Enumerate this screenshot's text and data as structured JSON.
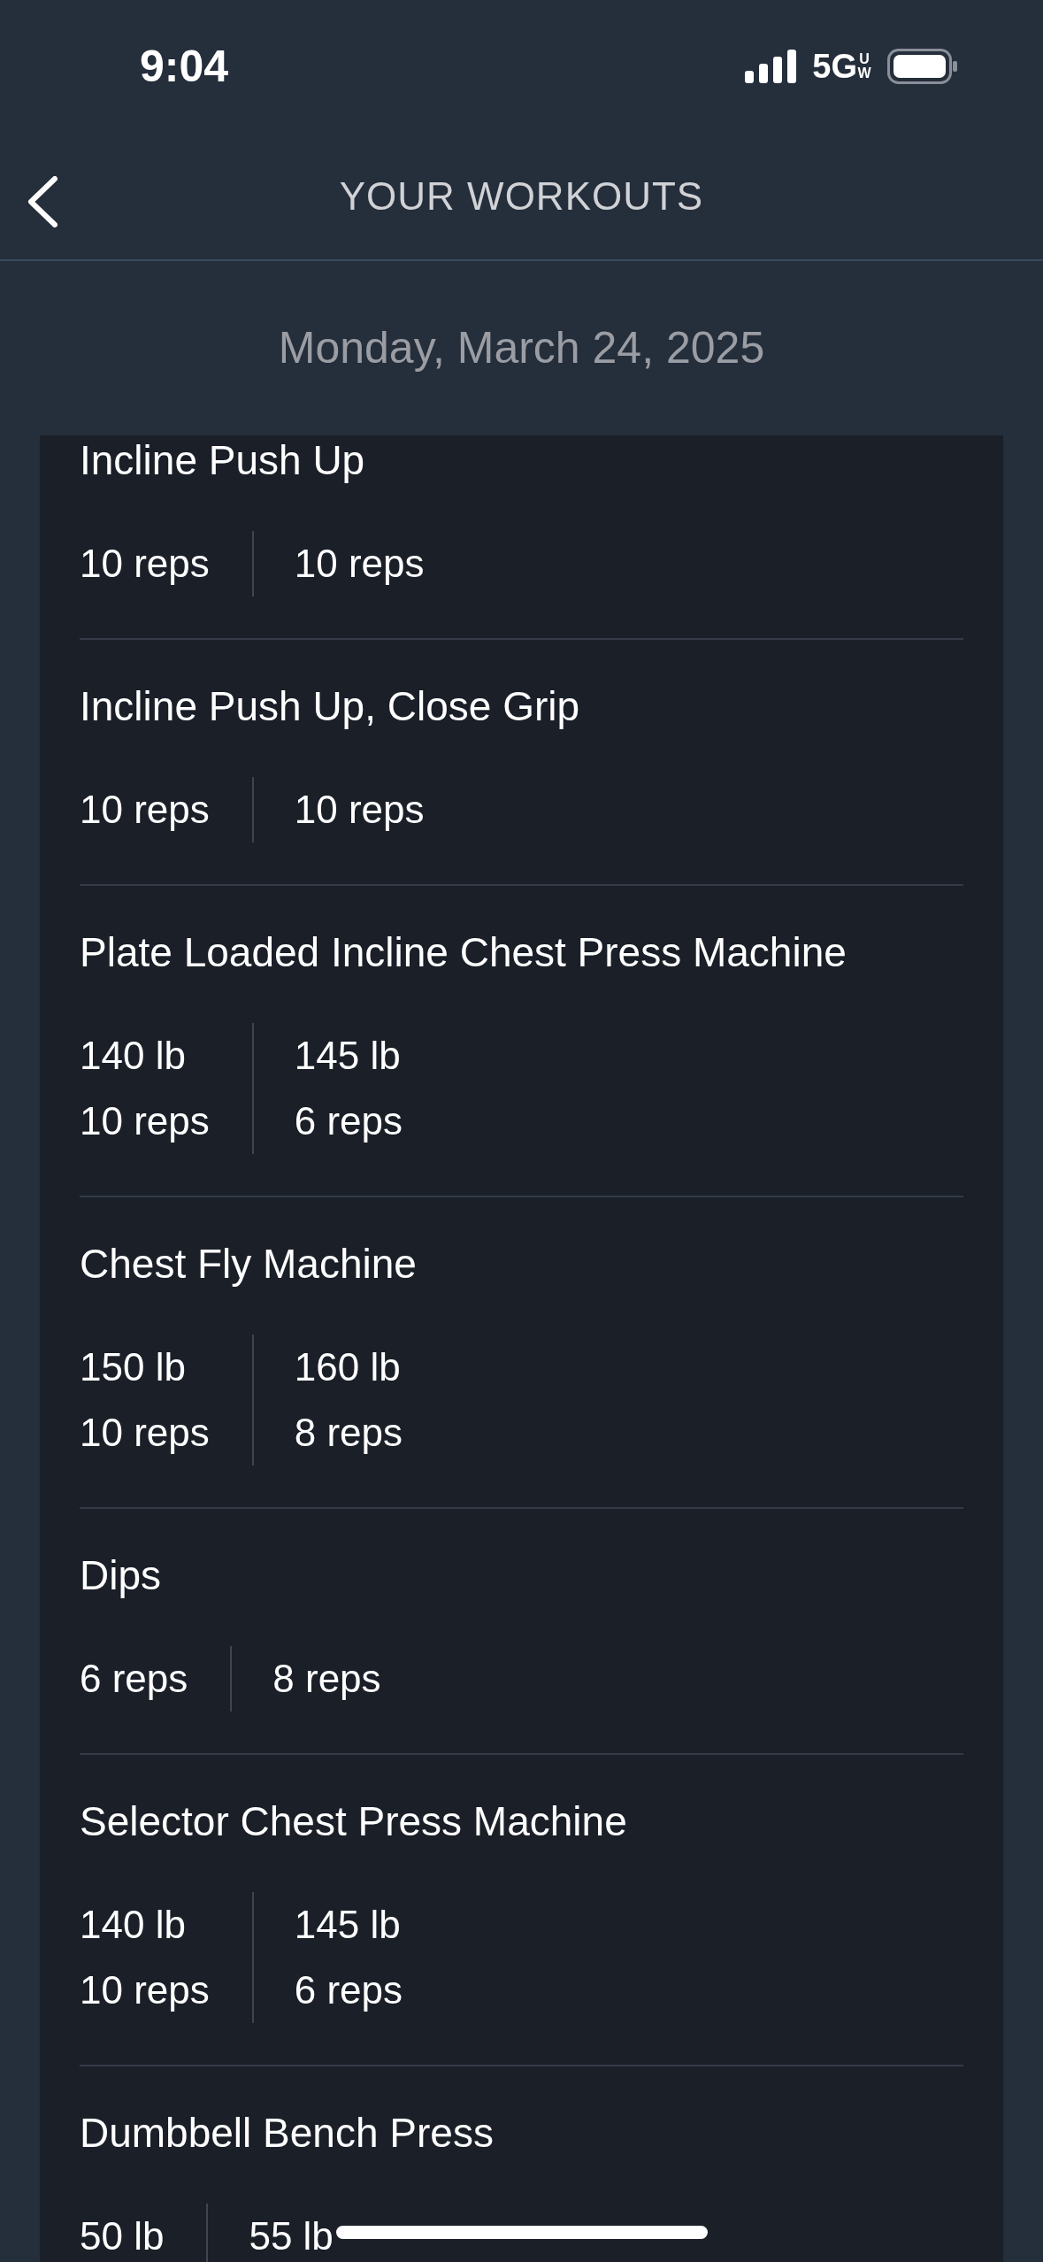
{
  "status_bar": {
    "time": "9:04",
    "network": "5G",
    "network_badge": "UW"
  },
  "header": {
    "title": "YOUR WORKOUTS"
  },
  "date": "Monday, March 24, 2025",
  "exercises": [
    {
      "name": "Incline Push Up",
      "sets": [
        {
          "reps": "10 reps"
        },
        {
          "reps": "10 reps"
        }
      ]
    },
    {
      "name": "Incline Push Up, Close Grip",
      "sets": [
        {
          "reps": "10 reps"
        },
        {
          "reps": "10 reps"
        }
      ]
    },
    {
      "name": "Plate Loaded Incline Chest Press Machine",
      "sets": [
        {
          "weight": "140 lb",
          "reps": "10 reps"
        },
        {
          "weight": "145 lb",
          "reps": "6 reps"
        }
      ]
    },
    {
      "name": "Chest Fly Machine",
      "sets": [
        {
          "weight": "150 lb",
          "reps": "10 reps"
        },
        {
          "weight": "160 lb",
          "reps": "8 reps"
        }
      ]
    },
    {
      "name": "Dips",
      "sets": [
        {
          "reps": "6 reps"
        },
        {
          "reps": "8 reps"
        }
      ]
    },
    {
      "name": "Selector Chest Press Machine",
      "sets": [
        {
          "weight": "140 lb",
          "reps": "10 reps"
        },
        {
          "weight": "145 lb",
          "reps": "6 reps"
        }
      ]
    },
    {
      "name": "Dumbbell Bench Press",
      "sets": [
        {
          "weight": "50 lb"
        },
        {
          "weight": "55 lb"
        }
      ]
    }
  ]
}
